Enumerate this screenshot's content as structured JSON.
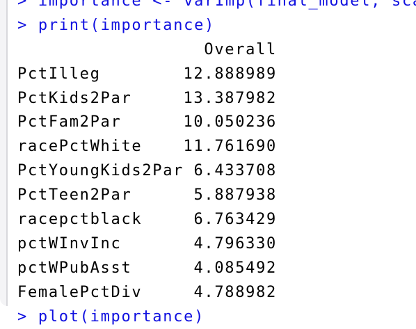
{
  "console": {
    "prompt": ">",
    "commands": [
      "importance <- varImp(final_model, sca",
      "print(importance)",
      "plot(importance)"
    ],
    "output": {
      "header": "Overall",
      "rows": [
        {
          "name": "PctIlleg",
          "value": "12.888989"
        },
        {
          "name": "PctKids2Par",
          "value": "13.387982"
        },
        {
          "name": "PctFam2Par",
          "value": "10.050236"
        },
        {
          "name": "racePctWhite",
          "value": "11.761690"
        },
        {
          "name": "PctYoungKids2Par",
          "value": "6.433708"
        },
        {
          "name": "PctTeen2Par",
          "value": "5.887938"
        },
        {
          "name": "racepctblack",
          "value": "6.763429"
        },
        {
          "name": "pctWInvInc",
          "value": "4.796330"
        },
        {
          "name": "pctWPubAsst",
          "value": "4.085492"
        },
        {
          "name": "FemalePctDiv",
          "value": "4.788982"
        }
      ]
    }
  }
}
